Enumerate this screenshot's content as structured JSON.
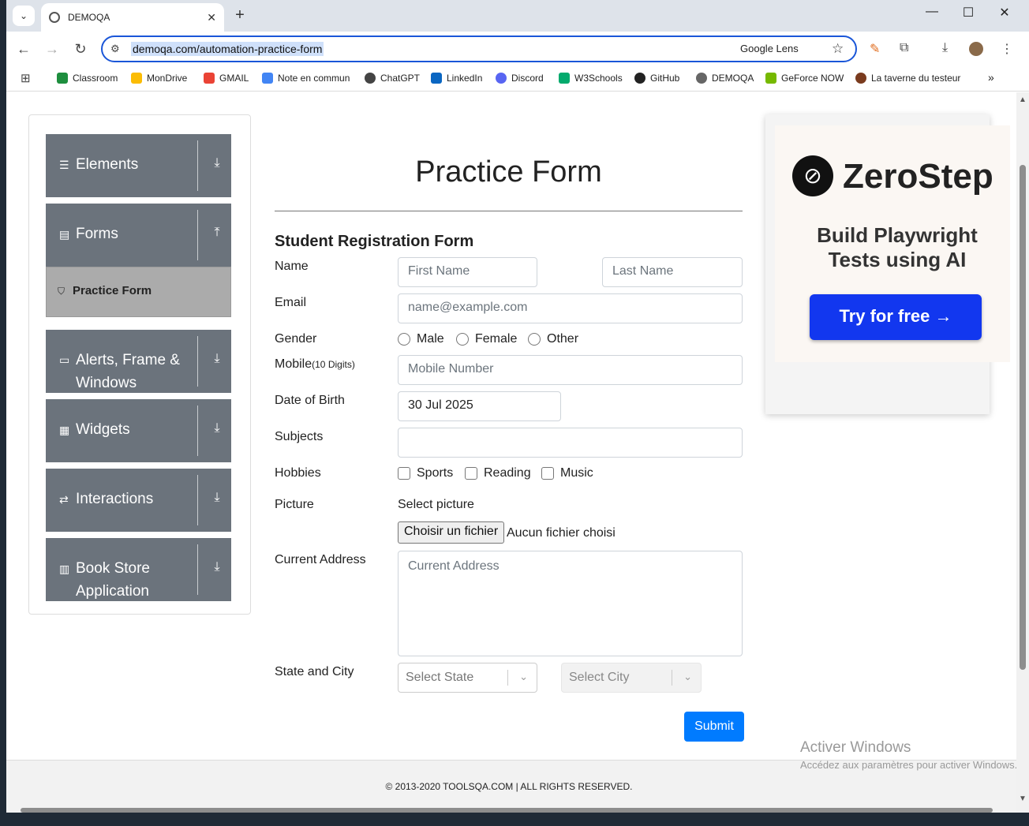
{
  "browser": {
    "tab_title": "DEMOQA",
    "tab_close": "✕",
    "tab_list": "⌄",
    "new_tab": "+",
    "win_min": "—",
    "win_max": "☐",
    "win_close": "✕",
    "url": "demoqa.com/automation-practice-form",
    "lens_label": "Google Lens",
    "star": "☆",
    "back": "←",
    "forward": "→",
    "reload": "↻",
    "tune": "⚙",
    "extensions": "⧉",
    "download": "⤓",
    "menu": "⋮",
    "more_bookmarks": "»"
  },
  "bookmarks": [
    {
      "label": "Classroom",
      "color": "#1e8e3e"
    },
    {
      "label": "MonDrive",
      "color": "#fbbc04"
    },
    {
      "label": "GMAIL",
      "color": "#ea4335"
    },
    {
      "label": "Note en commun",
      "color": "#4285f4"
    },
    {
      "label": "ChatGPT",
      "color": "#444444"
    },
    {
      "label": "LinkedIn",
      "color": "#0a66c2"
    },
    {
      "label": "Discord",
      "color": "#5865f2"
    },
    {
      "label": "W3Schools",
      "color": "#04aa6d"
    },
    {
      "label": "GitHub",
      "color": "#222222"
    },
    {
      "label": "DEMOQA",
      "color": "#666666"
    },
    {
      "label": "GeForce NOW",
      "color": "#76b900"
    },
    {
      "label": "La taverne du testeur",
      "color": "#7a3b1e"
    }
  ],
  "sidebar": {
    "groups": [
      {
        "label": "Elements",
        "arrow": "⤓",
        "icon": "☰"
      },
      {
        "label": "Forms",
        "arrow": "⤒",
        "icon": "▤"
      },
      {
        "label": "Alerts, Frame & Windows",
        "arrow": "⤓",
        "icon": "▭"
      },
      {
        "label": "Widgets",
        "arrow": "⤓",
        "icon": "▦"
      },
      {
        "label": "Interactions",
        "arrow": "⤓",
        "icon": "⇄"
      },
      {
        "label": "Book Store Application",
        "arrow": "⤓",
        "icon": "▥"
      }
    ],
    "active_item": "Practice Form"
  },
  "form": {
    "page_title": "Practice Form",
    "section_title": "Student Registration Form",
    "labels": {
      "name": "Name",
      "email": "Email",
      "gender": "Gender",
      "mobile": "Mobile",
      "mobile_hint": "(10 Digits)",
      "dob": "Date of Birth",
      "subjects": "Subjects",
      "hobbies": "Hobbies",
      "picture": "Picture",
      "address": "Current Address",
      "state_city": "State and City"
    },
    "placeholders": {
      "first_name": "First Name",
      "last_name": "Last Name",
      "email": "name@example.com",
      "mobile": "Mobile Number",
      "address": "Current Address"
    },
    "dob_value": "30 Jul 2025",
    "genders": [
      "Male",
      "Female",
      "Other"
    ],
    "hobbies": [
      "Sports",
      "Reading",
      "Music"
    ],
    "select_picture": "Select picture",
    "file_button": "Choisir un fichier",
    "file_status": "Aucun fichier choisi",
    "state_placeholder": "Select State",
    "city_placeholder": "Select City",
    "submit": "Submit"
  },
  "ad": {
    "brand": "ZeroStep",
    "tagline": "Build Playwright Tests using AI",
    "cta": "Try for free →"
  },
  "footer": {
    "copyright": "© 2013-2020 TOOLSQA.COM | ALL RIGHTS RESERVED."
  },
  "watermark": {
    "title": "Activer Windows",
    "subtitle": "Accédez aux paramètres pour activer Windows."
  }
}
